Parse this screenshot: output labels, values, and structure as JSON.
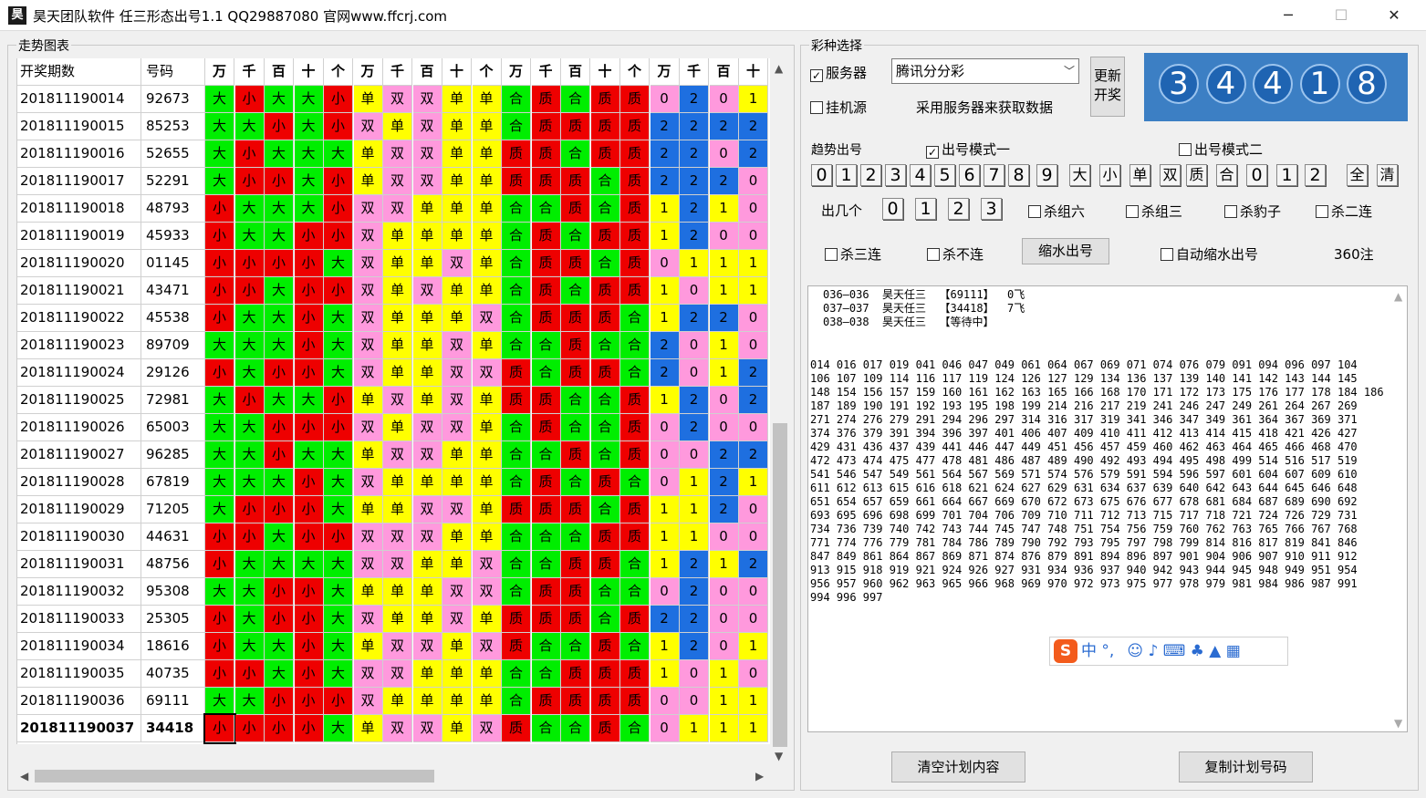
{
  "window": {
    "title": "昊天团队软件   任三形态出号1.1    QQ29887080    官网www.ffcrj.com",
    "icon_glyph": "昊",
    "min": "─",
    "max": "☐",
    "close": "✕"
  },
  "left": {
    "group_label": "走势图表",
    "headers": [
      "开奖期数",
      "号码",
      "万",
      "千",
      "百",
      "十",
      "个",
      "万",
      "千",
      "百",
      "十",
      "个",
      "万",
      "千",
      "百",
      "十",
      "个",
      "万",
      "千",
      "百",
      "十"
    ],
    "rows": [
      [
        "201811190014",
        "92673",
        "大",
        "小",
        "大",
        "大",
        "小",
        "单",
        "双",
        "双",
        "单",
        "单",
        "合",
        "质",
        "合",
        "质",
        "质",
        "0",
        "2",
        "0",
        "1"
      ],
      [
        "201811190015",
        "85253",
        "大",
        "大",
        "小",
        "大",
        "小",
        "双",
        "单",
        "双",
        "单",
        "单",
        "合",
        "质",
        "质",
        "质",
        "质",
        "2",
        "2",
        "2",
        "2"
      ],
      [
        "201811190016",
        "52655",
        "大",
        "小",
        "大",
        "大",
        "大",
        "单",
        "双",
        "双",
        "单",
        "单",
        "质",
        "质",
        "合",
        "质",
        "质",
        "2",
        "2",
        "0",
        "2"
      ],
      [
        "201811190017",
        "52291",
        "大",
        "小",
        "小",
        "大",
        "小",
        "单",
        "双",
        "双",
        "单",
        "单",
        "质",
        "质",
        "质",
        "合",
        "质",
        "2",
        "2",
        "2",
        "0"
      ],
      [
        "201811190018",
        "48793",
        "小",
        "大",
        "大",
        "大",
        "小",
        "双",
        "双",
        "单",
        "单",
        "单",
        "合",
        "合",
        "质",
        "合",
        "质",
        "1",
        "2",
        "1",
        "0"
      ],
      [
        "201811190019",
        "45933",
        "小",
        "大",
        "大",
        "小",
        "小",
        "双",
        "单",
        "单",
        "单",
        "单",
        "合",
        "质",
        "合",
        "质",
        "质",
        "1",
        "2",
        "0",
        "0"
      ],
      [
        "201811190020",
        "01145",
        "小",
        "小",
        "小",
        "小",
        "大",
        "双",
        "单",
        "单",
        "双",
        "单",
        "合",
        "质",
        "质",
        "合",
        "质",
        "0",
        "1",
        "1",
        "1"
      ],
      [
        "201811190021",
        "43471",
        "小",
        "小",
        "大",
        "小",
        "小",
        "双",
        "单",
        "双",
        "单",
        "单",
        "合",
        "质",
        "合",
        "质",
        "质",
        "1",
        "0",
        "1",
        "1"
      ],
      [
        "201811190022",
        "45538",
        "小",
        "大",
        "大",
        "小",
        "大",
        "双",
        "单",
        "单",
        "单",
        "双",
        "合",
        "质",
        "质",
        "质",
        "合",
        "1",
        "2",
        "2",
        "0"
      ],
      [
        "201811190023",
        "89709",
        "大",
        "大",
        "大",
        "小",
        "大",
        "双",
        "单",
        "单",
        "双",
        "单",
        "合",
        "合",
        "质",
        "合",
        "合",
        "2",
        "0",
        "1",
        "0"
      ],
      [
        "201811190024",
        "29126",
        "小",
        "大",
        "小",
        "小",
        "大",
        "双",
        "单",
        "单",
        "双",
        "双",
        "质",
        "合",
        "质",
        "质",
        "合",
        "2",
        "0",
        "1",
        "2"
      ],
      [
        "201811190025",
        "72981",
        "大",
        "小",
        "大",
        "大",
        "小",
        "单",
        "双",
        "单",
        "双",
        "单",
        "质",
        "质",
        "合",
        "合",
        "质",
        "1",
        "2",
        "0",
        "2"
      ],
      [
        "201811190026",
        "65003",
        "大",
        "大",
        "小",
        "小",
        "小",
        "双",
        "单",
        "双",
        "双",
        "单",
        "合",
        "质",
        "合",
        "合",
        "质",
        "0",
        "2",
        "0",
        "0"
      ],
      [
        "201811190027",
        "96285",
        "大",
        "大",
        "小",
        "大",
        "大",
        "单",
        "双",
        "双",
        "单",
        "单",
        "合",
        "合",
        "质",
        "合",
        "质",
        "0",
        "0",
        "2",
        "2"
      ],
      [
        "201811190028",
        "67819",
        "大",
        "大",
        "大",
        "小",
        "大",
        "双",
        "单",
        "单",
        "单",
        "单",
        "合",
        "质",
        "合",
        "质",
        "合",
        "0",
        "1",
        "2",
        "1"
      ],
      [
        "201811190029",
        "71205",
        "大",
        "小",
        "小",
        "小",
        "大",
        "单",
        "单",
        "双",
        "双",
        "单",
        "质",
        "质",
        "质",
        "合",
        "质",
        "1",
        "1",
        "2",
        "0"
      ],
      [
        "201811190030",
        "44631",
        "小",
        "小",
        "大",
        "小",
        "小",
        "双",
        "双",
        "双",
        "单",
        "单",
        "合",
        "合",
        "合",
        "质",
        "质",
        "1",
        "1",
        "0",
        "0"
      ],
      [
        "201811190031",
        "48756",
        "小",
        "大",
        "大",
        "大",
        "大",
        "双",
        "双",
        "单",
        "单",
        "双",
        "合",
        "合",
        "质",
        "质",
        "合",
        "1",
        "2",
        "1",
        "2"
      ],
      [
        "201811190032",
        "95308",
        "大",
        "大",
        "小",
        "小",
        "大",
        "单",
        "单",
        "单",
        "双",
        "双",
        "合",
        "质",
        "质",
        "合",
        "合",
        "0",
        "2",
        "0",
        "0"
      ],
      [
        "201811190033",
        "25305",
        "小",
        "大",
        "小",
        "小",
        "大",
        "双",
        "单",
        "单",
        "双",
        "单",
        "质",
        "质",
        "质",
        "合",
        "质",
        "2",
        "2",
        "0",
        "0"
      ],
      [
        "201811190034",
        "18616",
        "小",
        "大",
        "大",
        "小",
        "大",
        "单",
        "双",
        "双",
        "单",
        "双",
        "质",
        "合",
        "合",
        "质",
        "合",
        "1",
        "2",
        "0",
        "1"
      ],
      [
        "201811190035",
        "40735",
        "小",
        "小",
        "大",
        "小",
        "大",
        "双",
        "双",
        "单",
        "单",
        "单",
        "合",
        "合",
        "质",
        "质",
        "质",
        "1",
        "0",
        "1",
        "0"
      ],
      [
        "201811190036",
        "69111",
        "大",
        "大",
        "小",
        "小",
        "小",
        "双",
        "单",
        "单",
        "单",
        "单",
        "合",
        "质",
        "质",
        "质",
        "质",
        "0",
        "0",
        "1",
        "1"
      ],
      [
        "201811190037",
        "34418",
        "小",
        "小",
        "小",
        "小",
        "大",
        "单",
        "双",
        "双",
        "单",
        "双",
        "质",
        "合",
        "合",
        "质",
        "合",
        "0",
        "1",
        "1",
        "1"
      ]
    ]
  },
  "colors": {
    "大": "#00ee00",
    "小": "#ee0000",
    "单": "#ffff00",
    "双": "#ff99dd",
    "合": "#00ee00",
    "质": "#ee0000",
    "0": "#ff99dd",
    "1": "#ffff00",
    "2": "#1e6fe0"
  },
  "right": {
    "lottery_label": "彩种选择",
    "server_label": "服务器",
    "hang_label": "挂机源",
    "lottery_select": "腾讯分分彩",
    "server_note": "采用服务器来获取数据",
    "update_button": "更新\n开奖",
    "balls": [
      "3",
      "4",
      "4",
      "1",
      "8"
    ],
    "trend_label": "趋势出号",
    "mode1": "出号模式一",
    "mode2": "出号模式二",
    "digit_buttons": [
      "0",
      "1",
      "2",
      "3",
      "4",
      "5",
      "6",
      "7",
      "8",
      "9",
      "大",
      "小",
      "单",
      "双",
      "质",
      "合",
      "0",
      "1",
      "2",
      "全",
      "清"
    ],
    "count_label": "出几个",
    "count_buttons": [
      "0",
      "1",
      "2",
      "3"
    ],
    "kill_six": "杀组六",
    "kill_three": "杀组三",
    "kill_leopard": "杀豹子",
    "kill_two": "杀二连",
    "kill_three_in_row": "杀三连",
    "kill_none_in_row": "杀不连",
    "shrink_button": "缩水出号",
    "auto_shrink": "自动缩水出号",
    "note_count": "360注",
    "plan_lines": [
      "036—036  昊天任三  【69111】  0飞",
      "037—037  昊天任三  【34418】  7飞",
      "038—038  昊天任三  【等待中】"
    ],
    "numbers": [
      "014 016 017 019 041 046 047 049 061 064 067 069 071 074 076 079 091 094 096 097 104",
      "106 107 109 114 116 117 119 124 126 127 129 134 136 137 139 140 141 142 143 144 145",
      "148 154 156 157 159 160 161 162 163 165 166 168 170 171 172 173 175 176 177 178 184 186",
      "187 189 190 191 192 193 195 198 199 214 216 217 219 241 246 247 249 261 264 267 269",
      "271 274 276 279 291 294 296 297 314 316 317 319 341 346 347 349 361 364 367 369 371",
      "374 376 379 391 394 396 397 401 406 407 409 410 411 412 413 414 415 418 421 426 427",
      "429 431 436 437 439 441 446 447 449 451 456 457 459 460 462 463 464 465 466 468 470",
      "472 473 474 475 477 478 481 486 487 489 490 492 493 494 495 498 499 514 516 517 519",
      "541 546 547 549 561 564 567 569 571 574 576 579 591 594 596 597 601 604 607 609 610",
      "611 612 613 615 616 618 621 624 627 629 631 634 637 639 640 642 643 644 645 646 648",
      "651 654 657 659 661 664 667 669 670 672 673 675 676 677 678 681 684 687 689 690 692",
      "693 695 696 698 699 701 704 706 709 710 711 712 713 715 717 718 721 724 726 729 731",
      "734 736 739 740 742 743 744 745 747 748 751 754 756 759 760 762 763 765 766 767 768",
      "771 774 776 779 781 784 786 789 790 792 793 795 797 798 799 814 816 817 819 841 846",
      "847 849 861 864 867 869 871 874 876 879 891 894 896 897 901 904 906 907 910 911 912",
      "913 915 918 919 921 924 926 927 931 934 936 937 940 942 943 944 945 948 949 951 954",
      "956 957 960 962 963 965 966 968 969 970 972 973 975 977 978 979 981 984 986 987 991",
      "994 996 997"
    ],
    "clear_button": "清空计划内容",
    "copy_button": "复制计划号码",
    "ime_text": "中 °,"
  }
}
